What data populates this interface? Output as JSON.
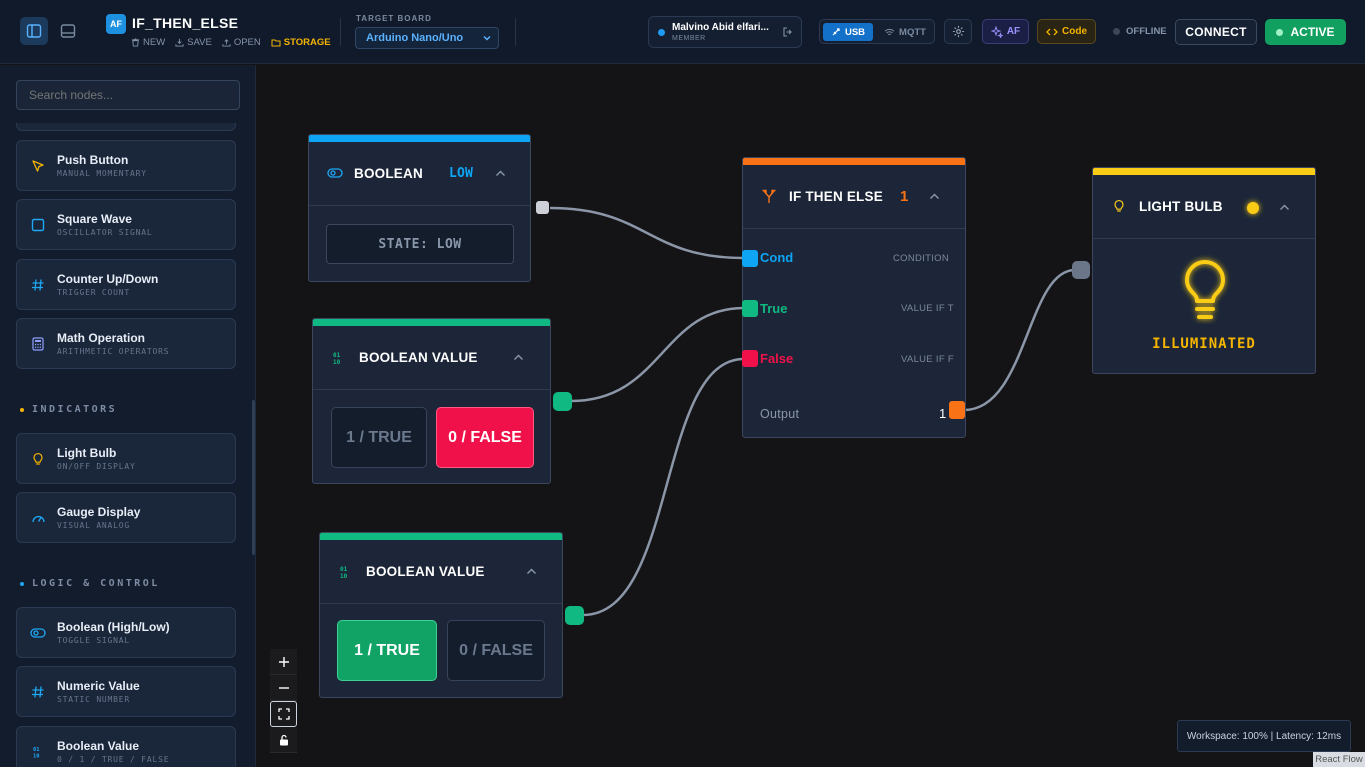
{
  "header": {
    "logo_badge": "AF",
    "project_title": "IF_THEN_ELSE",
    "actions": {
      "new": "NEW",
      "save": "SAVE",
      "open": "OPEN",
      "storage": "STORAGE"
    },
    "target_board_label": "TARGET BOARD",
    "target_board_value": "Arduino Nano/Uno",
    "user_name": "Malvino Abid elfari...",
    "user_role": "MEMBER",
    "usb_label": "USB",
    "mqtt_label": "MQTT",
    "af_label": "AF",
    "code_label": "Code",
    "status_label": "OFFLINE",
    "connect_label": "CONNECT",
    "active_label": "ACTIVE"
  },
  "sidebar": {
    "search_placeholder": "Search nodes...",
    "items_top": [
      {
        "title": "Push Button",
        "subtitle": "MANUAL MOMENTARY",
        "icon": "cursor-icon"
      },
      {
        "title": "Square Wave",
        "subtitle": "OSCILLATOR SIGNAL",
        "icon": "square-icon"
      },
      {
        "title": "Counter Up/Down",
        "subtitle": "TRIGGER COUNT",
        "icon": "hash-icon"
      },
      {
        "title": "Math Operation",
        "subtitle": "ARITHMETIC OPERATORS",
        "icon": "calculator-icon"
      }
    ],
    "section_indicators": "INDICATORS",
    "items_indicators": [
      {
        "title": "Light Bulb",
        "subtitle": "ON/OFF DISPLAY",
        "icon": "bulb-icon"
      },
      {
        "title": "Gauge Display",
        "subtitle": "VISUAL ANALOG",
        "icon": "gauge-icon"
      }
    ],
    "section_logic": "LOGIC & CONTROL",
    "items_logic": [
      {
        "title": "Boolean (High/Low)",
        "subtitle": "TOGGLE SIGNAL",
        "icon": "toggle-icon"
      },
      {
        "title": "Numeric Value",
        "subtitle": "STATIC NUMBER",
        "icon": "hash-icon"
      },
      {
        "title": "Boolean Value",
        "subtitle": "0 / 1 / TRUE / FALSE",
        "icon": "binary-icon"
      }
    ]
  },
  "nodes": {
    "boolean": {
      "title": "BOOLEAN",
      "badge": "LOW",
      "state": "STATE: LOW"
    },
    "bool_value_1": {
      "title": "BOOLEAN VALUE",
      "true_label": "1 / TRUE",
      "false_label": "0 / FALSE",
      "selected": "false"
    },
    "bool_value_2": {
      "title": "BOOLEAN VALUE",
      "true_label": "1 / TRUE",
      "false_label": "0 / FALSE",
      "selected": "true"
    },
    "if_then_else": {
      "title": "IF THEN ELSE",
      "badge": "1",
      "cond_label": "Cond",
      "cond_hint": "CONDITION",
      "true_label": "True",
      "true_hint": "VALUE IF T",
      "false_label": "False",
      "false_hint": "VALUE IF F",
      "output_label": "Output",
      "output_value": "1"
    },
    "light_bulb": {
      "title": "LIGHT BULB",
      "state": "ILLUMINATED"
    }
  },
  "canvas": {
    "status_text": "Workspace: 100% | Latency: 12ms",
    "attribution": "React Flow"
  },
  "colors": {
    "blue": "#0ea5f5",
    "green": "#10b981",
    "orange": "#f97316",
    "yellow": "#facc15",
    "red": "#f0114a"
  }
}
